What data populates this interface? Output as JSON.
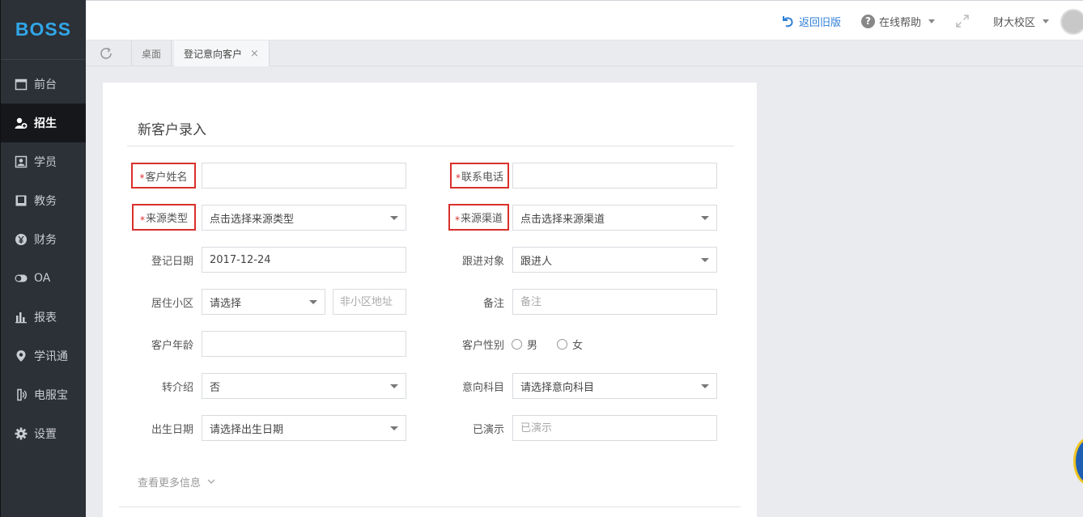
{
  "app": {
    "logo": "BOSS"
  },
  "sidebar": {
    "items": [
      {
        "label": "前台",
        "icon": "calendar-icon"
      },
      {
        "label": "招生",
        "icon": "user-add-icon",
        "active": true
      },
      {
        "label": "学员",
        "icon": "student-card-icon"
      },
      {
        "label": "教务",
        "icon": "book-icon"
      },
      {
        "label": "财务",
        "icon": "yen-icon"
      },
      {
        "label": "OA",
        "icon": "toggle-icon"
      },
      {
        "label": "报表",
        "icon": "bar-chart-icon"
      },
      {
        "label": "学讯通",
        "icon": "location-pin-icon"
      },
      {
        "label": "电服宝",
        "icon": "phone-icon"
      },
      {
        "label": "设置",
        "icon": "gear-icon"
      }
    ]
  },
  "header": {
    "back_label": "返回旧版",
    "help_label": "在线帮助",
    "campus_label": "财大校区"
  },
  "tabs": {
    "home_label": "桌面",
    "current_label": "登记意向客户",
    "close_symbol": "×"
  },
  "form": {
    "title": "新客户录入",
    "required_mark": "*",
    "customer_name": {
      "label": "客户姓名",
      "value": ""
    },
    "phone": {
      "label": "联系电话",
      "value": ""
    },
    "source_type": {
      "label": "来源类型",
      "value": "点击选择来源类型"
    },
    "source_channel": {
      "label": "来源渠道",
      "value": "点击选择来源渠道"
    },
    "register_date": {
      "label": "登记日期",
      "value": "2017-12-24"
    },
    "follow_target": {
      "label": "跟进对象",
      "value": "跟进人"
    },
    "community": {
      "label": "居住小区",
      "value": "请选择",
      "address_placeholder": "非小区地址"
    },
    "note": {
      "label": "备注",
      "placeholder": "备注"
    },
    "age": {
      "label": "客户年龄",
      "value": ""
    },
    "gender": {
      "label": "客户性别",
      "options": [
        "男",
        "女"
      ]
    },
    "referral": {
      "label": "转介绍",
      "value": "否"
    },
    "subject": {
      "label": "意向科目",
      "value": "请选择意向科目"
    },
    "birthday": {
      "label": "出生日期",
      "value": "请选择出生日期"
    },
    "demo": {
      "label": "已演示",
      "placeholder": "已演示"
    },
    "more_label": "查看更多信息"
  },
  "colors": {
    "accent": "#31a6e8",
    "link": "#2f7fd7",
    "required_box": "#d9302b",
    "sidebar_bg": "#2c3037"
  }
}
